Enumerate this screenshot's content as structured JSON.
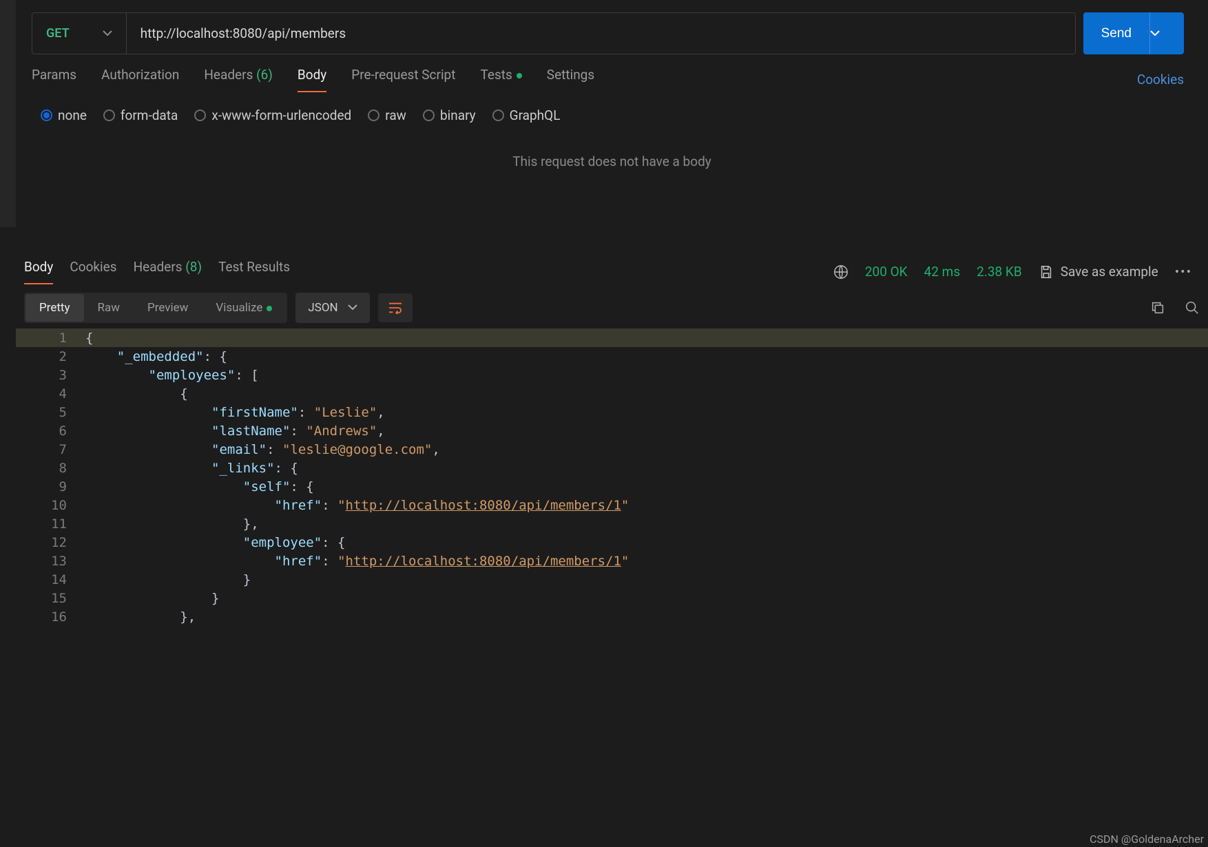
{
  "request": {
    "method": "GET",
    "url": "http://localhost:8080/api/members",
    "send_label": "Send"
  },
  "req_tabs": {
    "params": "Params",
    "auth": "Authorization",
    "headers": "Headers",
    "headers_count": "(6)",
    "body": "Body",
    "prs": "Pre-request Script",
    "tests": "Tests",
    "settings": "Settings",
    "cookies": "Cookies"
  },
  "body_types": {
    "none": "none",
    "form": "form-data",
    "urlenc": "x-www-form-urlencoded",
    "raw": "raw",
    "binary": "binary",
    "graphql": "GraphQL"
  },
  "body_msg": "This request does not have a body",
  "resp_tabs": {
    "body": "Body",
    "cookies": "Cookies",
    "headers": "Headers",
    "headers_count": "(8)",
    "testresults": "Test Results"
  },
  "status": {
    "code": "200 OK",
    "time": "42 ms",
    "size": "2.38 KB"
  },
  "save": "Save as example",
  "views": {
    "pretty": "Pretty",
    "raw": "Raw",
    "preview": "Preview",
    "visualize": "Visualize"
  },
  "format": "JSON",
  "json": {
    "key_embedded": "\"_embedded\"",
    "key_employees": "\"employees\"",
    "key_firstName": "\"firstName\"",
    "val_firstName": "\"Leslie\"",
    "key_lastName": "\"lastName\"",
    "val_lastName": "\"Andrews\"",
    "key_email": "\"email\"",
    "val_email": "\"leslie@google.com\"",
    "key_links": "\"_links\"",
    "key_self": "\"self\"",
    "key_href": "\"href\"",
    "val_href1": "http://localhost:8080/api/members/1",
    "key_employee": "\"employee\"",
    "val_href2": "http://localhost:8080/api/members/1"
  },
  "line_no": {
    "l1": "1",
    "l2": "2",
    "l3": "3",
    "l4": "4",
    "l5": "5",
    "l6": "6",
    "l7": "7",
    "l8": "8",
    "l9": "9",
    "l10": "10",
    "l11": "11",
    "l12": "12",
    "l13": "13",
    "l14": "14",
    "l15": "15",
    "l16": "16"
  },
  "watermark": "CSDN @GoldenaArcher"
}
